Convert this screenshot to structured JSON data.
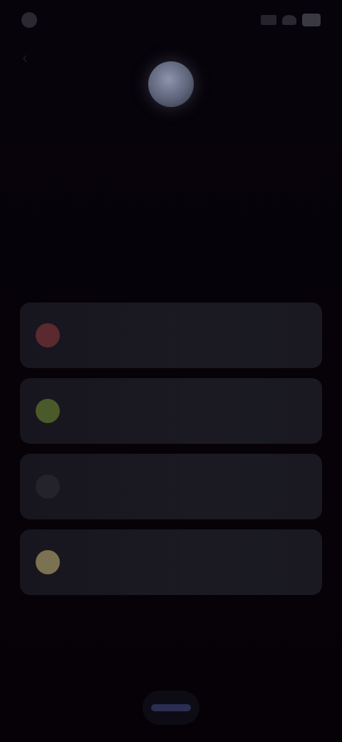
{
  "status_bar": {
    "time": "",
    "network_icon": "signal-icon",
    "wifi_icon": "wifi-icon",
    "battery_icon": "battery-icon"
  },
  "header": {
    "back_icon": "back-arrow-icon",
    "avatar_icon": "avatar-icon"
  },
  "main": {
    "heading": "",
    "options": [
      {
        "label": "",
        "icon": "red-circle-icon",
        "color": "#5a2a30"
      },
      {
        "label": "",
        "icon": "green-circle-icon",
        "color": "#4a5a2a"
      },
      {
        "label": "",
        "icon": "dark-circle-icon",
        "color": "#24232a"
      },
      {
        "label": "",
        "icon": "yellow-circle-icon",
        "color": "#7a7250"
      }
    ]
  },
  "footer": {
    "button_label": ""
  },
  "colors": {
    "background": "#060208",
    "card": "#1a1921",
    "accent": "#2b2d52"
  }
}
